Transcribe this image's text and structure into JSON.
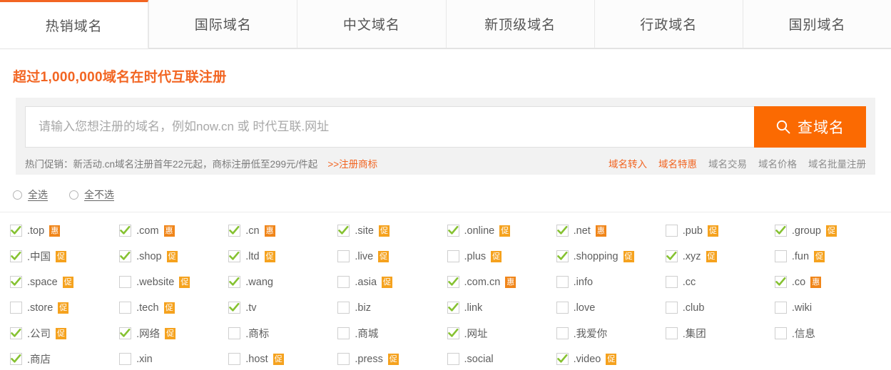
{
  "tabs": [
    {
      "label": "热销域名",
      "active": true
    },
    {
      "label": "国际域名",
      "active": false
    },
    {
      "label": "中文域名",
      "active": false
    },
    {
      "label": "新顶级域名",
      "active": false
    },
    {
      "label": "行政域名",
      "active": false
    },
    {
      "label": "国别域名",
      "active": false
    }
  ],
  "headline": "超过1,000,000域名在时代互联注册",
  "search": {
    "placeholder": "请输入您想注册的域名，例如now.cn 或 时代互联.网址",
    "value": "",
    "button_label": "查域名",
    "button_icon": "search-icon",
    "button_color": "#fb6a02"
  },
  "promo": {
    "text": "热门促销：新活动.cn域名注册首年22元起，商标注册低至299元/件起",
    "link": ">>注册商标",
    "links": [
      {
        "label": "域名转入",
        "highlight": true
      },
      {
        "label": "域名特惠",
        "highlight": true
      },
      {
        "label": "域名交易",
        "highlight": false
      },
      {
        "label": "域名价格",
        "highlight": false
      },
      {
        "label": "域名批量注册",
        "highlight": false
      }
    ]
  },
  "select_controls": [
    {
      "label": "全选",
      "checked": false
    },
    {
      "label": "全不选",
      "checked": false
    }
  ],
  "accent_color": "#f26522",
  "check_color": "#86c232",
  "badge_color": "#f5a21e",
  "tlds": [
    {
      "name": ".top",
      "checked": true,
      "badge": "惠"
    },
    {
      "name": ".com",
      "checked": true,
      "badge": "惠"
    },
    {
      "name": ".cn",
      "checked": true,
      "badge": "惠"
    },
    {
      "name": ".site",
      "checked": true,
      "badge": "促"
    },
    {
      "name": ".online",
      "checked": true,
      "badge": "促"
    },
    {
      "name": ".net",
      "checked": true,
      "badge": "惠"
    },
    {
      "name": ".pub",
      "checked": false,
      "badge": "促"
    },
    {
      "name": ".group",
      "checked": true,
      "badge": "促"
    },
    {
      "name": ".中国",
      "checked": true,
      "badge": "促"
    },
    {
      "name": ".shop",
      "checked": true,
      "badge": "促"
    },
    {
      "name": ".ltd",
      "checked": true,
      "badge": "促"
    },
    {
      "name": ".live",
      "checked": false,
      "badge": "促"
    },
    {
      "name": ".plus",
      "checked": false,
      "badge": "促"
    },
    {
      "name": ".shopping",
      "checked": true,
      "badge": "促"
    },
    {
      "name": ".xyz",
      "checked": true,
      "badge": "促"
    },
    {
      "name": ".fun",
      "checked": false,
      "badge": "促"
    },
    {
      "name": ".space",
      "checked": true,
      "badge": "促"
    },
    {
      "name": ".website",
      "checked": false,
      "badge": "促"
    },
    {
      "name": ".wang",
      "checked": true,
      "badge": ""
    },
    {
      "name": ".asia",
      "checked": false,
      "badge": "促"
    },
    {
      "name": ".com.cn",
      "checked": true,
      "badge": "惠"
    },
    {
      "name": ".info",
      "checked": false,
      "badge": ""
    },
    {
      "name": ".cc",
      "checked": false,
      "badge": ""
    },
    {
      "name": ".co",
      "checked": true,
      "badge": "惠"
    },
    {
      "name": ".store",
      "checked": false,
      "badge": "促"
    },
    {
      "name": ".tech",
      "checked": false,
      "badge": "促"
    },
    {
      "name": ".tv",
      "checked": true,
      "badge": ""
    },
    {
      "name": ".biz",
      "checked": false,
      "badge": ""
    },
    {
      "name": ".link",
      "checked": true,
      "badge": ""
    },
    {
      "name": ".love",
      "checked": false,
      "badge": ""
    },
    {
      "name": ".club",
      "checked": false,
      "badge": ""
    },
    {
      "name": ".wiki",
      "checked": false,
      "badge": ""
    },
    {
      "name": ".公司",
      "checked": true,
      "badge": "促"
    },
    {
      "name": ".网络",
      "checked": true,
      "badge": "促"
    },
    {
      "name": ".商标",
      "checked": false,
      "badge": ""
    },
    {
      "name": ".商城",
      "checked": false,
      "badge": ""
    },
    {
      "name": ".网址",
      "checked": true,
      "badge": ""
    },
    {
      "name": ".我爱你",
      "checked": false,
      "badge": ""
    },
    {
      "name": ".集团",
      "checked": false,
      "badge": ""
    },
    {
      "name": ".信息",
      "checked": false,
      "badge": ""
    },
    {
      "name": ".商店",
      "checked": true,
      "badge": ""
    },
    {
      "name": ".xin",
      "checked": false,
      "badge": ""
    },
    {
      "name": ".host",
      "checked": false,
      "badge": "促"
    },
    {
      "name": ".press",
      "checked": false,
      "badge": "促"
    },
    {
      "name": ".social",
      "checked": false,
      "badge": ""
    },
    {
      "name": ".video",
      "checked": true,
      "badge": "促"
    }
  ]
}
